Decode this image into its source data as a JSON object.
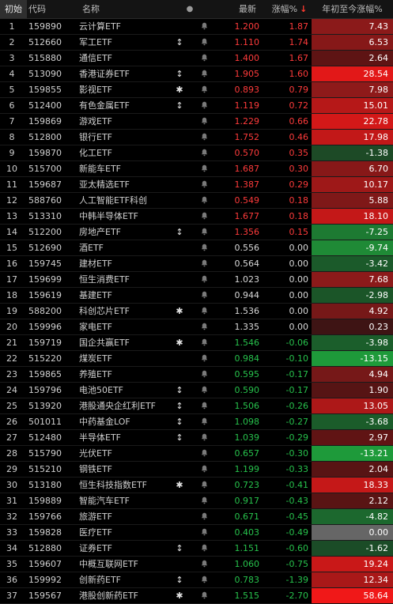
{
  "header": {
    "idx": "初始",
    "code": "代码",
    "name": "名称",
    "dot": "●",
    "price": "最新",
    "chg": "涨幅%",
    "chg_sort_arrow": "↓",
    "ytd": "年初至今涨幅%"
  },
  "colors": {
    "up_text": "#ff3b3b",
    "down_text": "#27c24c",
    "flat_text": "#d8d8d8",
    "ytd_neutral": "#666666"
  },
  "rows": [
    {
      "idx": "1",
      "code": "159890",
      "name": "云计算ETF",
      "flag": "",
      "bell": "bell-icon",
      "price": "1.200",
      "chg": "1.87",
      "ytd": "7.43",
      "dir": "up",
      "ytd_bg": "#8b1a1a"
    },
    {
      "idx": "2",
      "code": "512660",
      "name": "军工ETF",
      "flag": "↕",
      "bell": "bell-icon",
      "price": "1.110",
      "chg": "1.74",
      "ytd": "6.53",
      "dir": "up",
      "ytd_bg": "#861818"
    },
    {
      "idx": "3",
      "code": "515880",
      "name": "通信ETF",
      "flag": "",
      "bell": "bell-icon",
      "price": "1.400",
      "chg": "1.67",
      "ytd": "2.64",
      "dir": "up",
      "ytd_bg": "#5e1414"
    },
    {
      "idx": "4",
      "code": "513090",
      "name": "香港证券ETF",
      "flag": "↕",
      "bell": "bell-icon",
      "price": "1.905",
      "chg": "1.60",
      "ytd": "28.54",
      "dir": "up",
      "ytd_bg": "#e21818"
    },
    {
      "idx": "5",
      "code": "159855",
      "name": "影视ETF",
      "flag": "✱",
      "bell": "bell-icon",
      "price": "0.893",
      "chg": "0.79",
      "ytd": "7.98",
      "dir": "up",
      "ytd_bg": "#8e1a1a"
    },
    {
      "idx": "6",
      "code": "512400",
      "name": "有色金属ETF",
      "flag": "↕",
      "bell": "bell-icon",
      "price": "1.119",
      "chg": "0.72",
      "ytd": "15.01",
      "dir": "up",
      "ytd_bg": "#b61818"
    },
    {
      "idx": "7",
      "code": "159869",
      "name": "游戏ETF",
      "flag": "",
      "bell": "bell-icon",
      "price": "1.229",
      "chg": "0.66",
      "ytd": "22.78",
      "dir": "up",
      "ytd_bg": "#d31818"
    },
    {
      "idx": "8",
      "code": "512800",
      "name": "银行ETF",
      "flag": "",
      "bell": "bell-icon",
      "price": "1.752",
      "chg": "0.46",
      "ytd": "17.98",
      "dir": "up",
      "ytd_bg": "#c21818"
    },
    {
      "idx": "9",
      "code": "159870",
      "name": "化工ETF",
      "flag": "",
      "bell": "bell-icon",
      "price": "0.570",
      "chg": "0.35",
      "ytd": "-1.38",
      "dir": "up",
      "ytd_bg": "#1d4a26"
    },
    {
      "idx": "10",
      "code": "515700",
      "name": "新能车ETF",
      "flag": "",
      "bell": "bell-icon",
      "price": "1.687",
      "chg": "0.30",
      "ytd": "6.70",
      "dir": "up",
      "ytd_bg": "#871818"
    },
    {
      "idx": "11",
      "code": "159687",
      "name": "亚太精选ETF",
      "flag": "",
      "bell": "bell-icon",
      "price": "1.387",
      "chg": "0.29",
      "ytd": "10.17",
      "dir": "up",
      "ytd_bg": "#9e1818"
    },
    {
      "idx": "12",
      "code": "588760",
      "name": "人工智能ETF科创",
      "flag": "",
      "bell": "bell-icon",
      "price": "0.549",
      "chg": "0.18",
      "ytd": "5.88",
      "dir": "up",
      "ytd_bg": "#7f1818"
    },
    {
      "idx": "13",
      "code": "513310",
      "name": "中韩半导体ETF",
      "flag": "",
      "bell": "bell-icon",
      "price": "1.677",
      "chg": "0.18",
      "ytd": "18.10",
      "dir": "up",
      "ytd_bg": "#c41818"
    },
    {
      "idx": "14",
      "code": "512200",
      "name": "房地产ETF",
      "flag": "↕",
      "bell": "bell-icon",
      "price": "1.356",
      "chg": "0.15",
      "ytd": "-7.25",
      "dir": "up",
      "ytd_bg": "#1d7a32"
    },
    {
      "idx": "15",
      "code": "512690",
      "name": "酒ETF",
      "flag": "",
      "bell": "bell-icon",
      "price": "0.556",
      "chg": "0.00",
      "ytd": "-9.74",
      "dir": "flat",
      "ytd_bg": "#1f8a36"
    },
    {
      "idx": "16",
      "code": "159745",
      "name": "建材ETF",
      "flag": "",
      "bell": "bell-icon",
      "price": "0.564",
      "chg": "0.00",
      "ytd": "-3.42",
      "dir": "flat",
      "ytd_bg": "#1b5a2a"
    },
    {
      "idx": "17",
      "code": "159699",
      "name": "恒生消费ETF",
      "flag": "",
      "bell": "bell-icon",
      "price": "1.023",
      "chg": "0.00",
      "ytd": "7.68",
      "dir": "flat",
      "ytd_bg": "#8c1a1a"
    },
    {
      "idx": "18",
      "code": "159619",
      "name": "基建ETF",
      "flag": "",
      "bell": "bell-icon",
      "price": "0.944",
      "chg": "0.00",
      "ytd": "-2.98",
      "dir": "flat",
      "ytd_bg": "#1b5528"
    },
    {
      "idx": "19",
      "code": "588200",
      "name": "科创芯片ETF",
      "flag": "✱",
      "bell": "bell-icon",
      "price": "1.536",
      "chg": "0.00",
      "ytd": "4.92",
      "dir": "flat",
      "ytd_bg": "#761818"
    },
    {
      "idx": "20",
      "code": "159996",
      "name": "家电ETF",
      "flag": "",
      "bell": "bell-icon",
      "price": "1.335",
      "chg": "0.00",
      "ytd": "0.23",
      "dir": "flat",
      "ytd_bg": "#3e1414"
    },
    {
      "idx": "21",
      "code": "159719",
      "name": "国企共赢ETF",
      "flag": "✱",
      "bell": "bell-icon",
      "price": "1.546",
      "chg": "-0.06",
      "ytd": "-3.98",
      "dir": "down",
      "ytd_bg": "#1b5e2b"
    },
    {
      "idx": "22",
      "code": "515220",
      "name": "煤炭ETF",
      "flag": "",
      "bell": "bell-icon",
      "price": "0.984",
      "chg": "-0.10",
      "ytd": "-13.15",
      "dir": "down",
      "ytd_bg": "#1e9a3a"
    },
    {
      "idx": "23",
      "code": "159865",
      "name": "养殖ETF",
      "flag": "",
      "bell": "bell-icon",
      "price": "0.595",
      "chg": "-0.17",
      "ytd": "4.94",
      "dir": "down",
      "ytd_bg": "#761818"
    },
    {
      "idx": "24",
      "code": "159796",
      "name": "电池50ETF",
      "flag": "↕",
      "bell": "bell-icon",
      "price": "0.590",
      "chg": "-0.17",
      "ytd": "1.90",
      "dir": "down",
      "ytd_bg": "#561414"
    },
    {
      "idx": "25",
      "code": "513920",
      "name": "港股通央企红利ETF",
      "flag": "↕",
      "bell": "bell-icon",
      "price": "1.506",
      "chg": "-0.26",
      "ytd": "13.05",
      "dir": "down",
      "ytd_bg": "#ad1818"
    },
    {
      "idx": "26",
      "code": "501011",
      "name": "中药基金LOF",
      "flag": "↕",
      "bell": "bell-icon",
      "price": "1.098",
      "chg": "-0.27",
      "ytd": "-3.68",
      "dir": "down",
      "ytd_bg": "#1b5c2a"
    },
    {
      "idx": "27",
      "code": "512480",
      "name": "半导体ETF",
      "flag": "↕",
      "bell": "bell-icon",
      "price": "1.039",
      "chg": "-0.29",
      "ytd": "2.97",
      "dir": "down",
      "ytd_bg": "#601414"
    },
    {
      "idx": "28",
      "code": "515790",
      "name": "光伏ETF",
      "flag": "",
      "bell": "bell-icon",
      "price": "0.657",
      "chg": "-0.30",
      "ytd": "-13.21",
      "dir": "down",
      "ytd_bg": "#1e9a3a"
    },
    {
      "idx": "29",
      "code": "515210",
      "name": "钢铁ETF",
      "flag": "",
      "bell": "bell-icon",
      "price": "1.199",
      "chg": "-0.33",
      "ytd": "2.04",
      "dir": "down",
      "ytd_bg": "#581414"
    },
    {
      "idx": "30",
      "code": "513180",
      "name": "恒生科技指数ETF",
      "flag": "✱",
      "bell": "bell-icon",
      "price": "0.723",
      "chg": "-0.41",
      "ytd": "18.33",
      "dir": "down",
      "ytd_bg": "#c51818"
    },
    {
      "idx": "31",
      "code": "159889",
      "name": "智能汽车ETF",
      "flag": "",
      "bell": "bell-icon",
      "price": "0.917",
      "chg": "-0.43",
      "ytd": "2.12",
      "dir": "down",
      "ytd_bg": "#591414"
    },
    {
      "idx": "32",
      "code": "159766",
      "name": "旅游ETF",
      "flag": "",
      "bell": "bell-icon",
      "price": "0.671",
      "chg": "-0.45",
      "ytd": "-4.82",
      "dir": "down",
      "ytd_bg": "#1c682e"
    },
    {
      "idx": "33",
      "code": "159828",
      "name": "医疗ETF",
      "flag": "",
      "bell": "bell-icon",
      "price": "0.403",
      "chg": "-0.49",
      "ytd": "0.00",
      "dir": "down",
      "ytd_bg": "#666666"
    },
    {
      "idx": "34",
      "code": "512880",
      "name": "证券ETF",
      "flag": "↕",
      "bell": "bell-icon",
      "price": "1.151",
      "chg": "-0.60",
      "ytd": "-1.62",
      "dir": "down",
      "ytd_bg": "#1b4c27"
    },
    {
      "idx": "35",
      "code": "159607",
      "name": "中概互联网ETF",
      "flag": "",
      "bell": "bell-icon",
      "price": "1.060",
      "chg": "-0.75",
      "ytd": "19.24",
      "dir": "down",
      "ytd_bg": "#c91818"
    },
    {
      "idx": "36",
      "code": "159992",
      "name": "创新药ETF",
      "flag": "↕",
      "bell": "bell-icon",
      "price": "0.783",
      "chg": "-1.39",
      "ytd": "12.34",
      "dir": "down",
      "ytd_bg": "#a91818"
    },
    {
      "idx": "37",
      "code": "159567",
      "name": "港股创新药ETF",
      "flag": "✱",
      "bell": "bell-icon",
      "price": "1.515",
      "chg": "-2.70",
      "ytd": "58.64",
      "dir": "down",
      "ytd_bg": "#f01818"
    }
  ]
}
